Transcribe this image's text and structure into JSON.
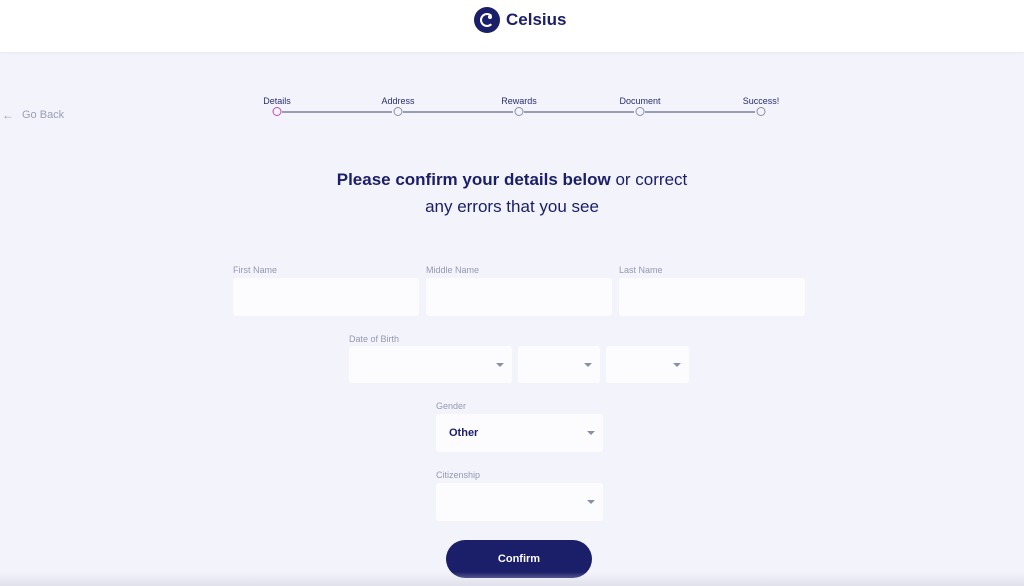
{
  "header": {
    "brand": "Celsius"
  },
  "nav": {
    "go_back": "Go Back"
  },
  "steps": [
    {
      "label": "Details",
      "active": true
    },
    {
      "label": "Address",
      "active": false
    },
    {
      "label": "Rewards",
      "active": false
    },
    {
      "label": "Document",
      "active": false
    },
    {
      "label": "Success!",
      "active": false
    }
  ],
  "heading": {
    "bold": "Please confirm your details below",
    "rest_line1": "or correct",
    "line2": "any errors that you see"
  },
  "form": {
    "first_name": {
      "label": "First Name",
      "value": ""
    },
    "middle_name": {
      "label": "Middle Name",
      "value": ""
    },
    "last_name": {
      "label": "Last Name",
      "value": ""
    },
    "dob": {
      "label": "Date of Birth"
    },
    "gender": {
      "label": "Gender",
      "value": "Other"
    },
    "citizenship": {
      "label": "Citizenship",
      "value": ""
    }
  },
  "confirm_label": "Confirm",
  "colors": {
    "primary": "#1b1e68",
    "active_step": "#c04bb9",
    "background": "#f3f4fb"
  }
}
